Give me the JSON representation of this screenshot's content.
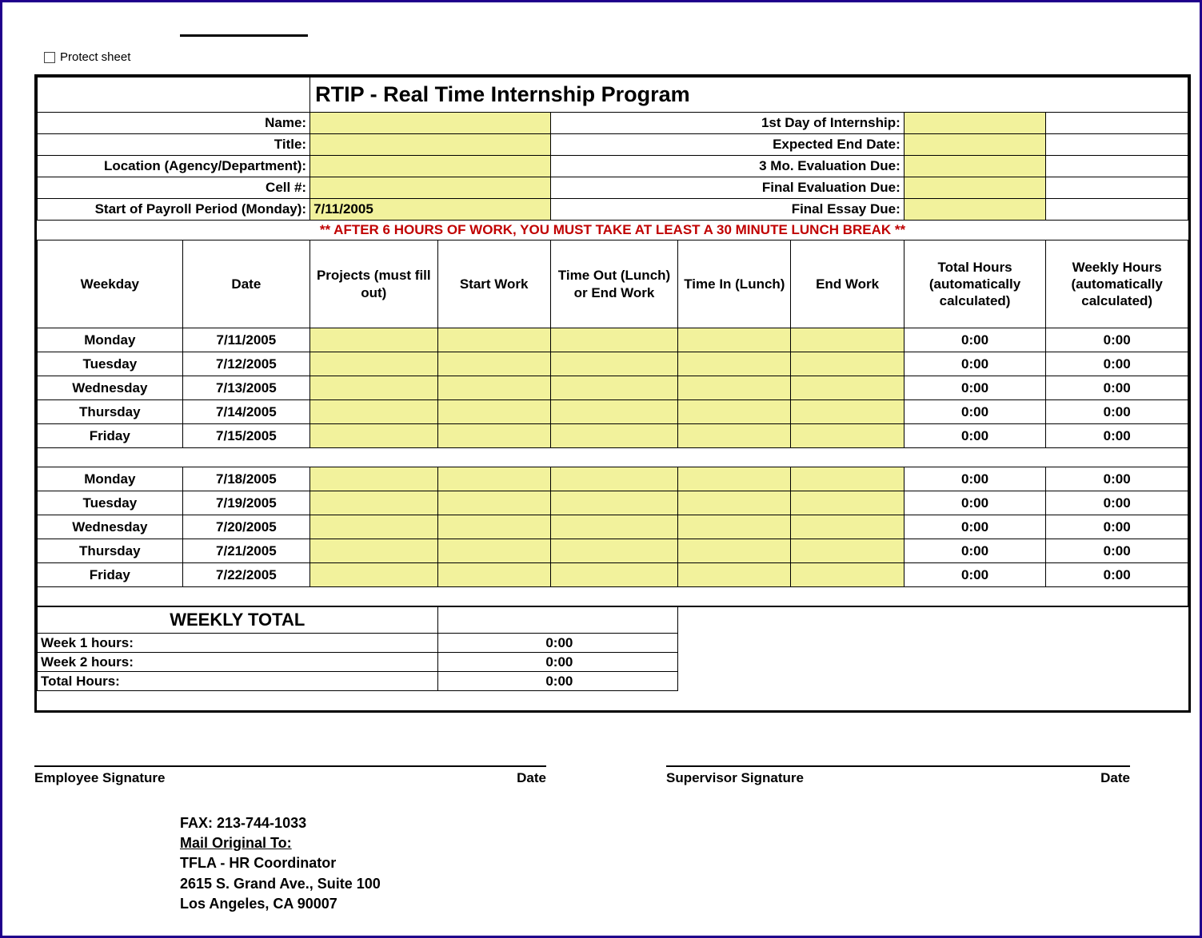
{
  "toolbar": {
    "protect_label": "Protect sheet"
  },
  "header": {
    "title": "RTIP - Real Time Internship Program",
    "labels": {
      "name": "Name:",
      "title": "Title:",
      "location": "Location (Agency/Department):",
      "cell": "Cell #:",
      "payroll_start": "Start of Payroll Period (Monday):",
      "first_day": "1st Day of Internship:",
      "expected_end": "Expected End Date:",
      "eval3mo": "3 Mo. Evaluation Due:",
      "final_eval": "Final Evaluation Due:",
      "final_essay": "Final Essay Due:"
    },
    "values": {
      "payroll_start": "7/11/2005"
    },
    "notice": "** AFTER 6 HOURS OF WORK, YOU MUST TAKE AT LEAST A 30 MINUTE LUNCH BREAK **"
  },
  "columns": {
    "weekday": "Weekday",
    "date": "Date",
    "projects": "Projects (must fill out)",
    "start": "Start Work",
    "timeout": "Time Out (Lunch) or End Work",
    "timein": "Time In (Lunch)",
    "end": "End Work",
    "total": "Total Hours (automatically calculated)",
    "weekly": "Weekly Hours (automatically calculated)"
  },
  "rows": [
    {
      "weekday": "Monday",
      "date": "7/11/2005",
      "total": "0:00",
      "weekly": "0:00"
    },
    {
      "weekday": "Tuesday",
      "date": "7/12/2005",
      "total": "0:00",
      "weekly": "0:00"
    },
    {
      "weekday": "Wednesday",
      "date": "7/13/2005",
      "total": "0:00",
      "weekly": "0:00"
    },
    {
      "weekday": "Thursday",
      "date": "7/14/2005",
      "total": "0:00",
      "weekly": "0:00"
    },
    {
      "weekday": "Friday",
      "date": "7/15/2005",
      "total": "0:00",
      "weekly": "0:00"
    },
    {
      "weekday": "Monday",
      "date": "7/18/2005",
      "total": "0:00",
      "weekly": "0:00"
    },
    {
      "weekday": "Tuesday",
      "date": "7/19/2005",
      "total": "0:00",
      "weekly": "0:00"
    },
    {
      "weekday": "Wednesday",
      "date": "7/20/2005",
      "total": "0:00",
      "weekly": "0:00"
    },
    {
      "weekday": "Thursday",
      "date": "7/21/2005",
      "total": "0:00",
      "weekly": "0:00"
    },
    {
      "weekday": "Friday",
      "date": "7/22/2005",
      "total": "0:00",
      "weekly": "0:00"
    }
  ],
  "weekly_total": {
    "title": "WEEKLY TOTAL",
    "week1_label": "Week 1 hours:",
    "week1_value": "0:00",
    "week2_label": "Week 2 hours:",
    "week2_value": "0:00",
    "total_label": "Total Hours:",
    "total_value": "0:00"
  },
  "signatures": {
    "employee": "Employee Signature",
    "date": "Date",
    "supervisor": "Supervisor Signature"
  },
  "info": {
    "fax": "FAX:  213-744-1033",
    "mail_to": "Mail Original To:",
    "line1": "TFLA - HR Coordinator",
    "line2": "2615 S. Grand Ave., Suite 100",
    "line3": "Los Angeles, CA 90007"
  }
}
